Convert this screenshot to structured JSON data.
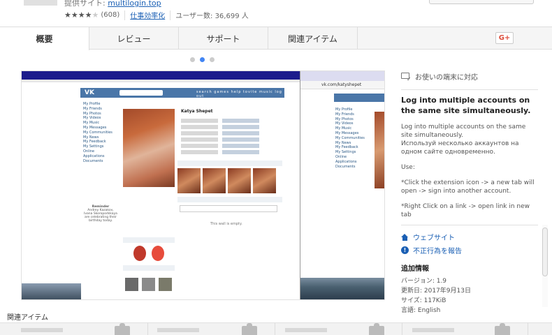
{
  "header": {
    "provider_label": "提供サイト:",
    "provider_link": "multilogin.top",
    "rating_stars": "★★★★",
    "rating_empty_star": "★",
    "rating_count": "(608)",
    "category": "仕事効率化",
    "users": "ユーザー数: 36,699 人"
  },
  "tabs": [
    {
      "label": "概要"
    },
    {
      "label": "レビュー"
    },
    {
      "label": "サポート"
    },
    {
      "label": "関連アイテム"
    }
  ],
  "share": {
    "gplus_label": "G+"
  },
  "carousel": {
    "dot_count": 3,
    "active_index": 1
  },
  "screenshot": {
    "vk_logo": "VK",
    "vk_nav": "search  games  help  tovite  music  log out",
    "left_menu": [
      "My Profile",
      "My Friends",
      "My Photos",
      "My Videos",
      "My Music",
      "My Messages",
      "My Communities",
      "My News",
      "My Feedback",
      "My Settings",
      "Online",
      "Applications",
      "Documents"
    ],
    "profile_name": "Katya Shepet",
    "wall_empty": "This wall is empty.",
    "reminder": "Reminder",
    "reminder_text": "Andrey Kazakov, Ivana Skoropodskaya are celebrating their birthday today.",
    "side_url": "vk.com/katyshepet"
  },
  "details": {
    "device": "お使いの端末に対応",
    "title": "Log into multiple accounts on the same site simultaneously.",
    "paragraphs": [
      "Log into multiple accounts on the same site simultaneously.\nИспользуй несколько аккаунтов на одном сайте одновременно.",
      "Use:",
      "*Click the extension icon -> a new tab will open -> sign into another account.",
      "*Right Click on a link -> open link in new tab"
    ],
    "website_link": "ウェブサイト",
    "report_link": "不正行為を報告",
    "additional_title": "追加情報",
    "version": "バージョン: 1.9",
    "updated": "更新日: 2017年9月13日",
    "size": "サイズ: 117KiB",
    "language": "言語: English"
  },
  "related": {
    "title": "関連アイテム"
  },
  "colors": {
    "accent": "#4285f4",
    "link": "#1a5fb4",
    "vk": "#4a76a8",
    "gplus": "#dd4b39"
  }
}
